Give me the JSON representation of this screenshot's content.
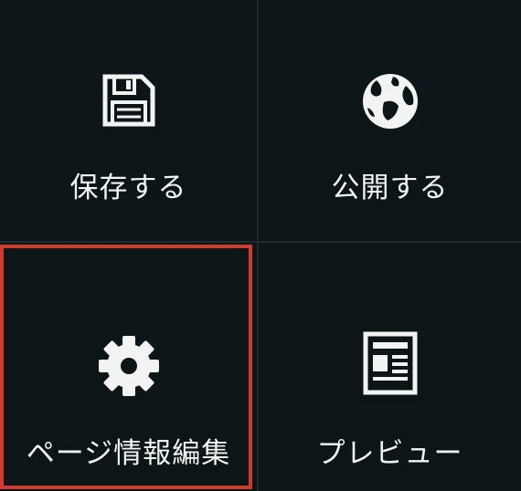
{
  "menu": {
    "items": [
      {
        "label": "保存する",
        "icon": "floppy-disk-icon"
      },
      {
        "label": "公開する",
        "icon": "globe-icon"
      },
      {
        "label": "ページ情報編集",
        "icon": "gear-icon"
      },
      {
        "label": "プレビュー",
        "icon": "document-icon"
      }
    ],
    "highlight_color": "#d23a30"
  }
}
